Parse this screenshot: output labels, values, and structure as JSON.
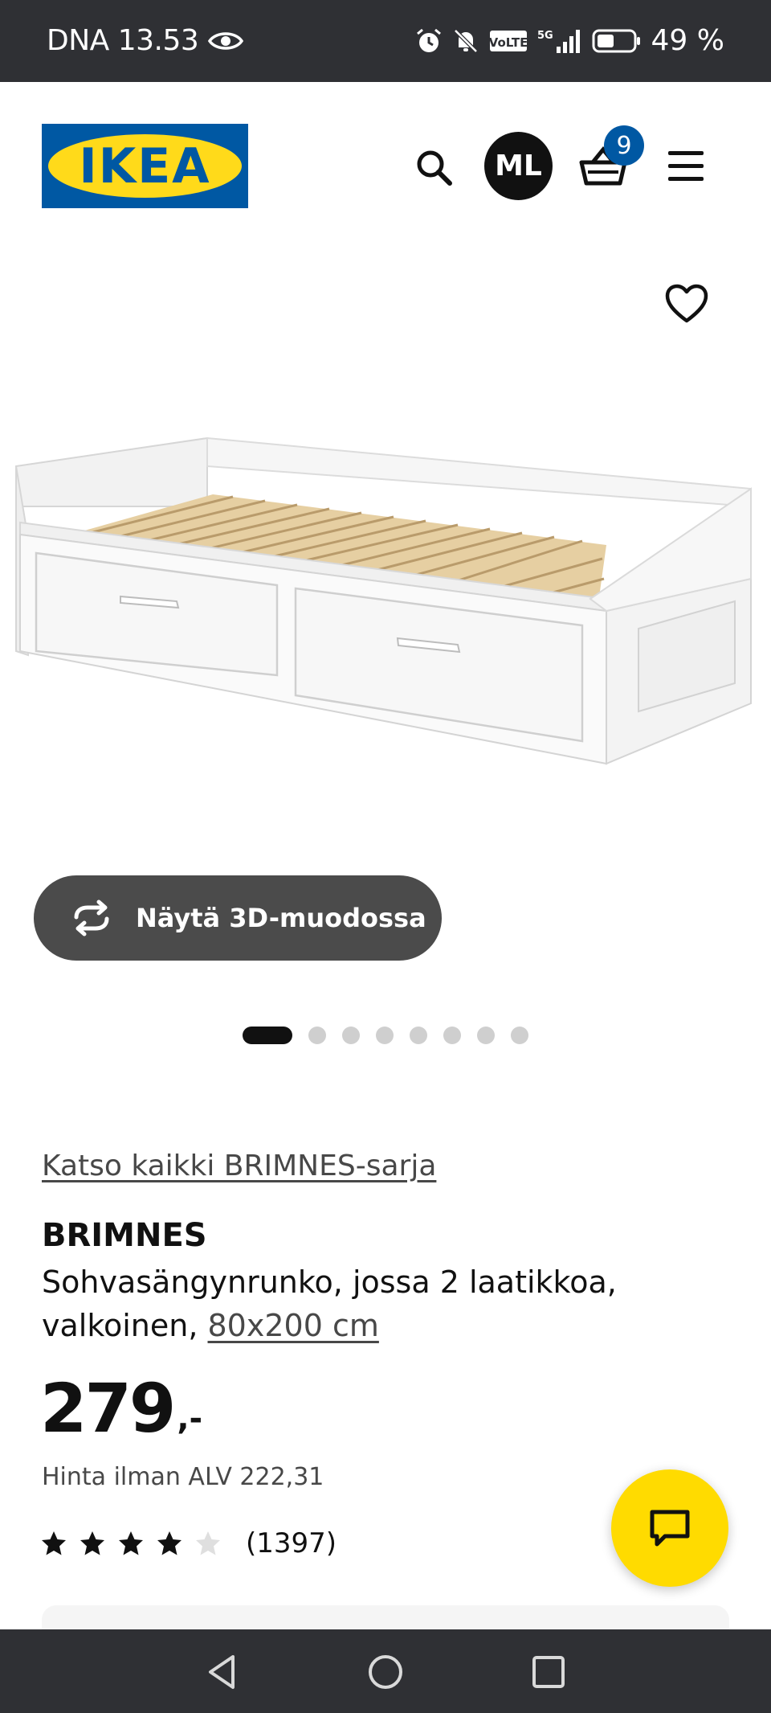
{
  "status_bar": {
    "carrier_time": "DNA 13.53",
    "network": "VoLTE",
    "network_gen": "5G",
    "battery": "49 %"
  },
  "header": {
    "logo_text": "IKEA",
    "avatar_initials": "ML",
    "cart_count": "9"
  },
  "product": {
    "view_3d_label": "Näytä 3D-muodossa",
    "carousel": {
      "total": 8,
      "active_index": 0
    },
    "series_link": "Katso kaikki BRIMNES-sarja",
    "name": "BRIMNES",
    "description": "Sohvasängynrunko, jossa 2 laatikkoa, valkoinen, ",
    "size": "80x200 cm",
    "price": "279",
    "price_suffix ": ",-",
    "price_ex_vat": "Hinta ilman ALV 222,31",
    "rating": {
      "stars": 4,
      "max": 5,
      "count": "(1397)"
    }
  },
  "colors": {
    "ikea_blue": "#0058a3",
    "ikea_yellow": "#ffda1a",
    "chat_yellow": "#ffdb00",
    "system_bar": "#2f3034"
  },
  "icons": {
    "search": "search-icon",
    "cart": "cart-icon",
    "menu": "hamburger-menu-icon",
    "favorite": "heart-icon",
    "rotate_3d": "rotate-3d-icon",
    "chat": "chat-icon"
  }
}
